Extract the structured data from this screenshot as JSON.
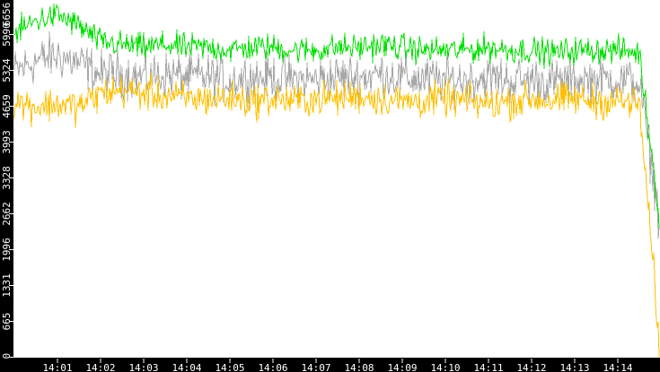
{
  "chart_data": {
    "type": "line",
    "title": "",
    "xlabel": "",
    "ylabel": "",
    "ylim": [
      0,
      6656
    ],
    "xlim": [
      "14:00:00",
      "14:15:00"
    ],
    "grid": false,
    "y_ticks": [
      "0",
      "665",
      "1331",
      "1996",
      "2662",
      "3328",
      "3993",
      "4659",
      "5324",
      "5990",
      "6656"
    ],
    "y_tick_values": [
      0,
      665,
      1331,
      1996,
      2662,
      3328,
      3993,
      4659,
      5324,
      5990,
      6656
    ],
    "x_ticks": [
      "14:01",
      "14:02",
      "14:03",
      "14:04",
      "14:05",
      "14:06",
      "14:07",
      "14:08",
      "14:09",
      "14:10",
      "14:11",
      "14:12",
      "14:13",
      "14:14"
    ],
    "x_tick_minutes": [
      1,
      2,
      3,
      4,
      5,
      6,
      7,
      8,
      9,
      10,
      11,
      12,
      13,
      14
    ],
    "sample_interval_seconds": 30,
    "series": [
      {
        "name": "gray",
        "color": "#a8a8a8",
        "spread": 650,
        "values": [
          5300,
          5500,
          5600,
          5450,
          5250,
          5250,
          5200,
          5250,
          5200,
          5200,
          5150,
          5200,
          5200,
          5150,
          5150,
          5200,
          5200,
          5250,
          5200,
          5150,
          5150,
          5150,
          5200,
          5150,
          5150,
          5100,
          5150,
          5150,
          5150,
          5100,
          2400
        ]
      },
      {
        "name": "green",
        "color": "#00e000",
        "spread": 380,
        "values": [
          6000,
          6250,
          6350,
          6150,
          5850,
          5800,
          5750,
          5800,
          5750,
          5750,
          5700,
          5750,
          5750,
          5700,
          5700,
          5750,
          5750,
          5800,
          5750,
          5700,
          5700,
          5700,
          5750,
          5700,
          5700,
          5650,
          5700,
          5700,
          5700,
          5650,
          2400
        ]
      },
      {
        "name": "yellow",
        "color": "#ffc000",
        "spread": 480,
        "values": [
          4750,
          4650,
          4700,
          4650,
          4900,
          4950,
          4900,
          4850,
          4800,
          4800,
          4800,
          4750,
          4800,
          4750,
          4800,
          4800,
          4850,
          4800,
          4750,
          4750,
          4800,
          4750,
          4700,
          4750,
          4800,
          4750,
          4800,
          4750,
          4750,
          4700,
          0
        ]
      }
    ]
  }
}
